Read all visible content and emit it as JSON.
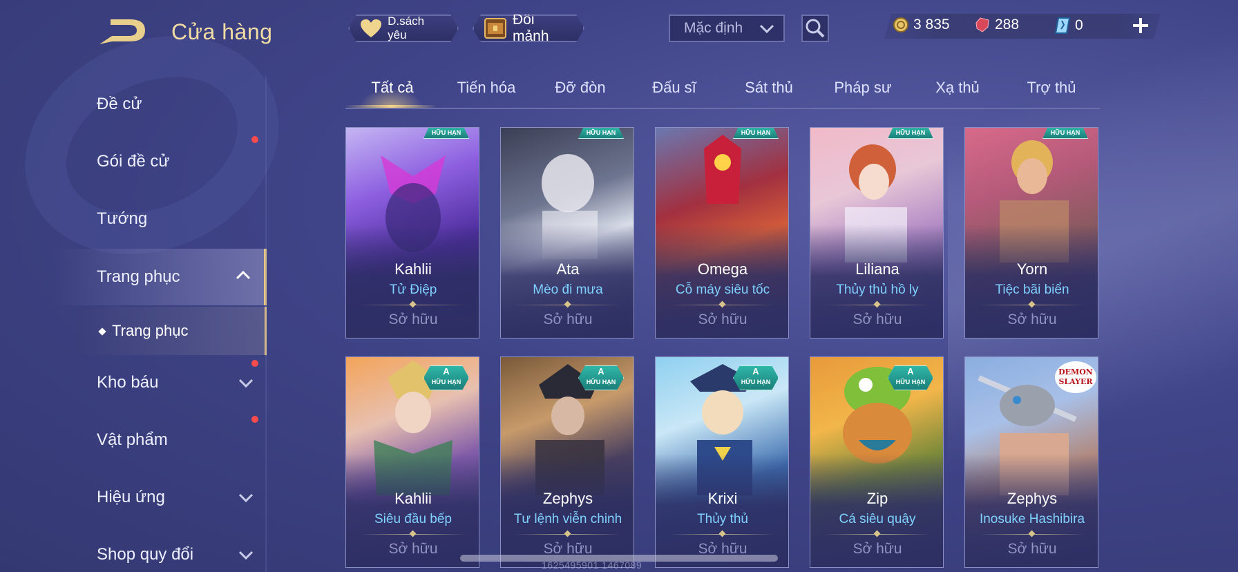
{
  "header": {
    "title": "Cửa hàng",
    "wishlist_label": "D.sách yêu",
    "exchange_label": "Đổi mảnh",
    "sort_selected": "Mặc định"
  },
  "currency": {
    "gold": "3 835",
    "ruby": "288",
    "voucher": "0"
  },
  "sidebar": {
    "items": [
      {
        "label": "Đề cử"
      },
      {
        "label": "Gói đề cử"
      },
      {
        "label": "Tướng"
      },
      {
        "label": "Trang phục"
      },
      {
        "label": "Kho báu"
      },
      {
        "label": "Vật phẩm"
      },
      {
        "label": "Hiệu ứng"
      },
      {
        "label": "Shop quy đổi"
      }
    ],
    "sub_item": "Trang phục"
  },
  "tabs": [
    "Tất cả",
    "Tiến hóa",
    "Đỡ đòn",
    "Đấu sĩ",
    "Sát thủ",
    "Pháp sư",
    "Xạ thủ",
    "Trợ thủ"
  ],
  "active_tab": "Tất cả",
  "badges": {
    "limited": "HỮU HẠN",
    "rank_a": "A",
    "demon_slayer_line1": "DEMON",
    "demon_slayer_line2": "SLAYER"
  },
  "cards": [
    {
      "hero": "Kahlii",
      "skin": "Tử Điệp",
      "status": "Sở hữu"
    },
    {
      "hero": "Ata",
      "skin": "Mèo đi mưa",
      "status": "Sở hữu"
    },
    {
      "hero": "Omega",
      "skin": "Cỗ máy siêu tốc",
      "status": "Sở hữu"
    },
    {
      "hero": "Liliana",
      "skin": "Thủy thủ hồ ly",
      "status": "Sở hữu"
    },
    {
      "hero": "Yorn",
      "skin": "Tiệc bãi biển",
      "status": "Sở hữu"
    },
    {
      "hero": "Kahlii",
      "skin": "Siêu đầu bếp",
      "status": "Sở hữu"
    },
    {
      "hero": "Zephys",
      "skin": "Tư lệnh viễn chinh",
      "status": "Sở hữu"
    },
    {
      "hero": "Krixi",
      "skin": "Thủy thủ",
      "status": "Sở hữu"
    },
    {
      "hero": "Zip",
      "skin": "Cá siêu quậy",
      "status": "Sở hữu"
    },
    {
      "hero": "Zephys",
      "skin": "Inosuke Hashibira",
      "status": "Sở hữu"
    }
  ],
  "colors": {
    "accent_gold": "#e8c780",
    "skin_name": "#7fd2ff",
    "notification_dot": "#ff4b4b",
    "limited_tag": "#2fb7a7"
  },
  "watermark": "1625495901 1467089"
}
